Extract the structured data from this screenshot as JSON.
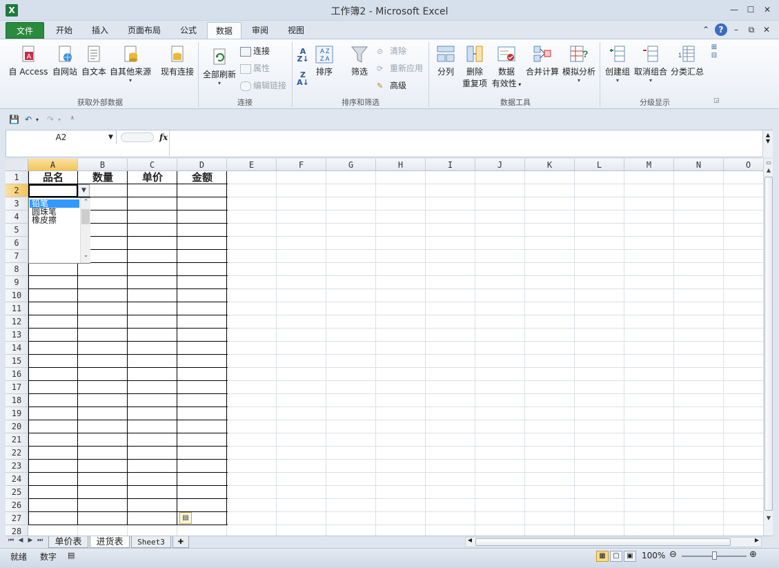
{
  "window": {
    "title": "工作簿2 - Microsoft Excel",
    "app_icon": "X"
  },
  "tabs": [
    "文件",
    "开始",
    "插入",
    "页面布局",
    "公式",
    "数据",
    "审阅",
    "视图"
  ],
  "ribbon": {
    "groups": {
      "external": {
        "label": "获取外部数据",
        "buttons": [
          "自 Access",
          "自网站",
          "自文本",
          "自其他来源",
          "现有连接"
        ]
      },
      "connections": {
        "label": "连接",
        "refresh": "全部刷新",
        "connect": "连接",
        "properties": "属性",
        "edit_links": "编辑链接"
      },
      "sort_filter": {
        "label": "排序和筛选",
        "sort": "排序",
        "filter": "筛选",
        "clear": "清除",
        "reapply": "重新应用",
        "advanced": "高级"
      },
      "data_tools": {
        "label": "数据工具",
        "split": "分列",
        "dedupe_1": "删除",
        "dedupe_2": "重复项",
        "validation_1": "数据",
        "validation_2": "有效性",
        "consolidate": "合并计算",
        "whatif": "模拟分析"
      },
      "outline": {
        "label": "分级显示",
        "group": "创建组",
        "ungroup": "取消组合",
        "subtotal": "分类汇总"
      }
    }
  },
  "formula_bar": {
    "name_box": "A2",
    "fx": "fx",
    "value": ""
  },
  "columns": [
    "A",
    "B",
    "C",
    "D",
    "E",
    "F",
    "G",
    "H",
    "I",
    "J",
    "K",
    "L",
    "M",
    "N",
    "O"
  ],
  "rows": [
    "1",
    "2",
    "3",
    "4",
    "5",
    "6",
    "7",
    "8",
    "9",
    "10",
    "11",
    "12",
    "13",
    "14",
    "15",
    "16",
    "17",
    "18",
    "19",
    "20",
    "21",
    "22",
    "23",
    "24",
    "25",
    "26",
    "27",
    "28"
  ],
  "headers": {
    "a1": "品名",
    "b1": "数量",
    "c1": "单价",
    "d1": "金额"
  },
  "dropdown": {
    "items": [
      "铅笔",
      "圆珠笔",
      "橡皮擦"
    ],
    "selected": "铅笔"
  },
  "sheets": [
    "单价表",
    "进货表",
    "Sheet3"
  ],
  "active_sheet": "进货表",
  "status": {
    "ready": "就绪",
    "mode": "数字",
    "zoom": "100%"
  },
  "colors": {
    "file_tab": "#2a8a3e",
    "selected_header": "#f2c45c",
    "list_highlight": "#3399ff"
  }
}
